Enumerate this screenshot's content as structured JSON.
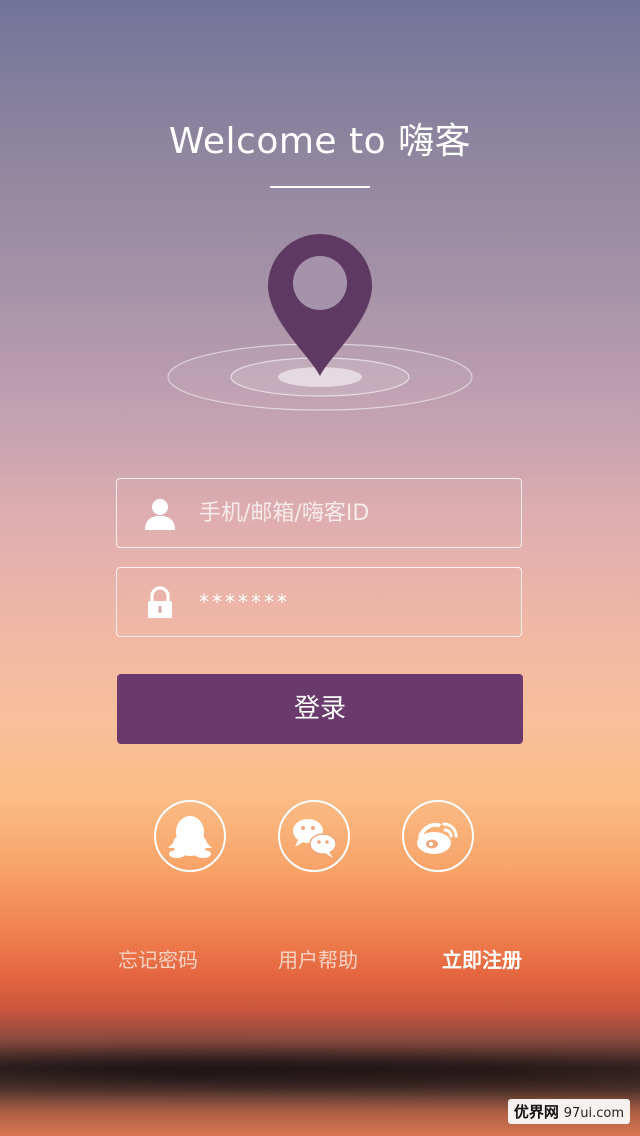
{
  "header": {
    "title": "Welcome to 嗨客"
  },
  "login_form": {
    "username_placeholder": "手机/邮箱/嗨客ID",
    "username_value": "",
    "password_value": "*******",
    "login_label": "登录"
  },
  "social_login": {
    "items": [
      {
        "name": "qq",
        "icon": "qq-penguin-icon"
      },
      {
        "name": "wechat",
        "icon": "wechat-icon"
      },
      {
        "name": "weibo",
        "icon": "weibo-icon"
      }
    ]
  },
  "footer_links": {
    "forgot_password": "忘记密码",
    "user_help": "用户帮助",
    "register_now": "立即注册"
  },
  "watermark": {
    "brand": "优界网",
    "domain": "97ui.com"
  },
  "colors": {
    "accent_button": "#693a6b",
    "pin": "#5e3a63",
    "text_primary": "#ffffff"
  }
}
